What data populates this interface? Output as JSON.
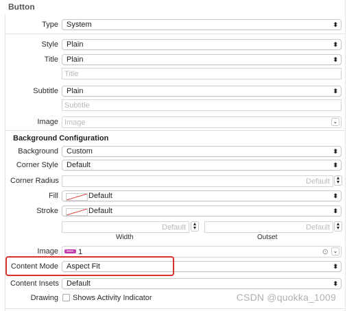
{
  "section_title": "Button",
  "rows": {
    "type": {
      "label": "Type",
      "value": "System"
    },
    "style": {
      "label": "Style",
      "value": "Plain"
    },
    "title": {
      "label": "Title",
      "value": "Plain",
      "placeholder": "Title"
    },
    "subtitle": {
      "label": "Subtitle",
      "value": "Plain",
      "placeholder": "Subtitle"
    },
    "image": {
      "label": "Image",
      "placeholder": "Image"
    }
  },
  "bg_config": {
    "title": "Background Configuration",
    "background": {
      "label": "Background",
      "value": "Custom"
    },
    "corner_style": {
      "label": "Corner Style",
      "value": "Default"
    },
    "corner_radius": {
      "label": "Corner Radius",
      "placeholder": "Default"
    },
    "fill": {
      "label": "Fill",
      "value": "Default"
    },
    "stroke": {
      "label": "Stroke",
      "value": "Default"
    },
    "width": {
      "placeholder": "Default",
      "caption": "Width"
    },
    "outset": {
      "placeholder": "Default",
      "caption": "Outset"
    },
    "image": {
      "label": "Image",
      "value": "1"
    },
    "content_mode": {
      "label": "Content Mode",
      "value": "Aspect Fit"
    },
    "content_insets": {
      "label": "Content Insets",
      "value": "Default"
    },
    "drawing": {
      "label": "Drawing",
      "checkbox_label": "Shows Activity Indicator"
    }
  },
  "watermark": "CSDN @quokka_1009",
  "colors": {
    "highlight": "#d9302c",
    "swatch_slash": "#e53935",
    "image_swatch": "#c43fb0"
  },
  "icons": {
    "popup": "chevron-up-down-icon",
    "combo": "chevron-down-icon",
    "image_clear": "circle-icon"
  }
}
